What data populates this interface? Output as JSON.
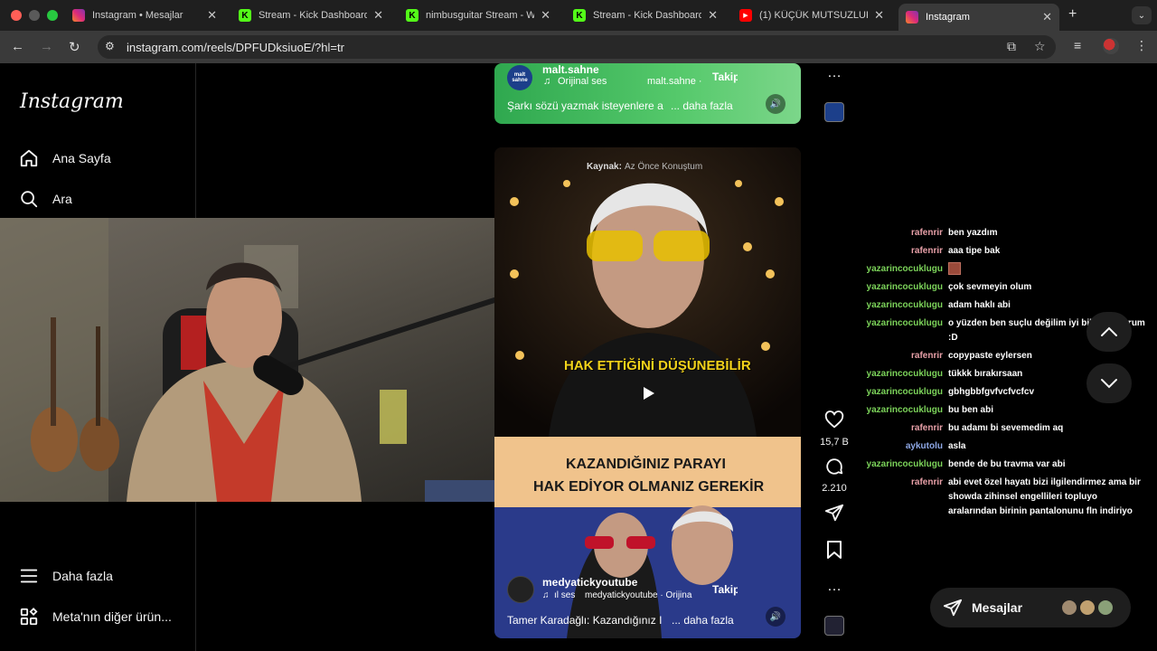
{
  "browser": {
    "tabs": [
      {
        "label": "Instagram • Mesajlar",
        "icon": "instagram-icon",
        "color": "#e1306c"
      },
      {
        "label": "Stream - Kick Dashboard",
        "icon": "kick-icon",
        "color": "#53fc18"
      },
      {
        "label": "nimbusguitar Stream - W",
        "icon": "kick-icon",
        "color": "#53fc18"
      },
      {
        "label": "Stream - Kick Dashboard",
        "icon": "kick-icon",
        "color": "#53fc18"
      },
      {
        "label": "(1) KÜÇÜK MUTSUZLUK",
        "icon": "youtube-icon",
        "color": "#ff0000"
      },
      {
        "label": "Instagram",
        "icon": "instagram-icon",
        "color": "#e1306c"
      }
    ],
    "url": "instagram.com/reels/DPFUDksiuoE/?hl=tr"
  },
  "sidebar": {
    "logo": "Instagram",
    "items": [
      {
        "label": "Ana Sayfa",
        "icon": "home-icon"
      },
      {
        "label": "Ara",
        "icon": "search-icon"
      },
      {
        "label": "Daha fazla",
        "icon": "menu-icon"
      },
      {
        "label": "Meta'nın diğer ürün...",
        "icon": "apps-icon"
      }
    ]
  },
  "reel_top": {
    "username": "malt.sahne",
    "audio": "Orijinal ses",
    "audio_owner": "malt.sahne ·",
    "follow": "Takip",
    "caption": "Şarkı sözü yazmak isteyenlere a",
    "more": "... daha fazla",
    "avatar_text": "malt sahne"
  },
  "reel_main": {
    "source_label": "Kaynak:",
    "source_value": "Az Önce Konuştum",
    "subtitle": "HAK ETTİĞİNİ DÜŞÜNEBİLİR",
    "banner_line1": "KAZANDIĞINIZ PARAYI",
    "banner_line2": "HAK EDİYOR OLMANIZ GEREKİR",
    "username": "medyatickyoutube",
    "audio": "ıl ses",
    "audio_owner": "medyatickyoutube · Orijina",
    "follow": "Takip",
    "caption": "Tamer Karadağlı: Kazandığınız I",
    "more": "... daha fazla"
  },
  "actions": {
    "likes": "15,7 B",
    "comments": "2.210"
  },
  "chat": [
    {
      "user": "rafenrir",
      "color": "#e8a0a8",
      "msg": "ben yazdım"
    },
    {
      "user": "rafenrir",
      "color": "#e8a0a8",
      "msg": "aaa tipe bak"
    },
    {
      "user": "yazarincocuklugu",
      "color": "#7cd35a",
      "msg": ""
    },
    {
      "user": "yazarincocuklugu",
      "color": "#7cd35a",
      "msg": "çok sevmeyin olum"
    },
    {
      "user": "yazarincocuklugu",
      "color": "#7cd35a",
      "msg": "adam haklı abi"
    },
    {
      "user": "yazarincocuklugu",
      "color": "#7cd35a",
      "msg": "o yüzden ben suçlu değilim iyi bile yapıyorum :D"
    },
    {
      "user": "rafenrir",
      "color": "#e8a0a8",
      "msg": "copypaste eylersen"
    },
    {
      "user": "yazarincocuklugu",
      "color": "#7cd35a",
      "msg": "tükkk bırakırsaan"
    },
    {
      "user": "yazarincocuklugu",
      "color": "#7cd35a",
      "msg": "gbhgbbfgvfvcfvcfcv"
    },
    {
      "user": "yazarincocuklugu",
      "color": "#7cd35a",
      "msg": "bu ben abi"
    },
    {
      "user": "rafenrir",
      "color": "#e8a0a8",
      "msg": "bu adamı bi sevemedim aq"
    },
    {
      "user": "aykutolu",
      "color": "#8ea8e6",
      "msg": "asla"
    },
    {
      "user": "yazarincocuklugu",
      "color": "#7cd35a",
      "msg": "bende de bu travma var abi"
    },
    {
      "user": "rafenrir",
      "color": "#e8a0a8",
      "msg": "abi evet özel hayatı bizi ilgilendirmez ama bir showda zihinsel engellileri topluyo aralarından birinin pantalonunu fln indiriyo"
    }
  ],
  "messages_button": {
    "label": "Mesajlar"
  },
  "colors": {
    "background": "#000000",
    "accent": "#f5f5f5",
    "banner": "#f0c38c"
  }
}
